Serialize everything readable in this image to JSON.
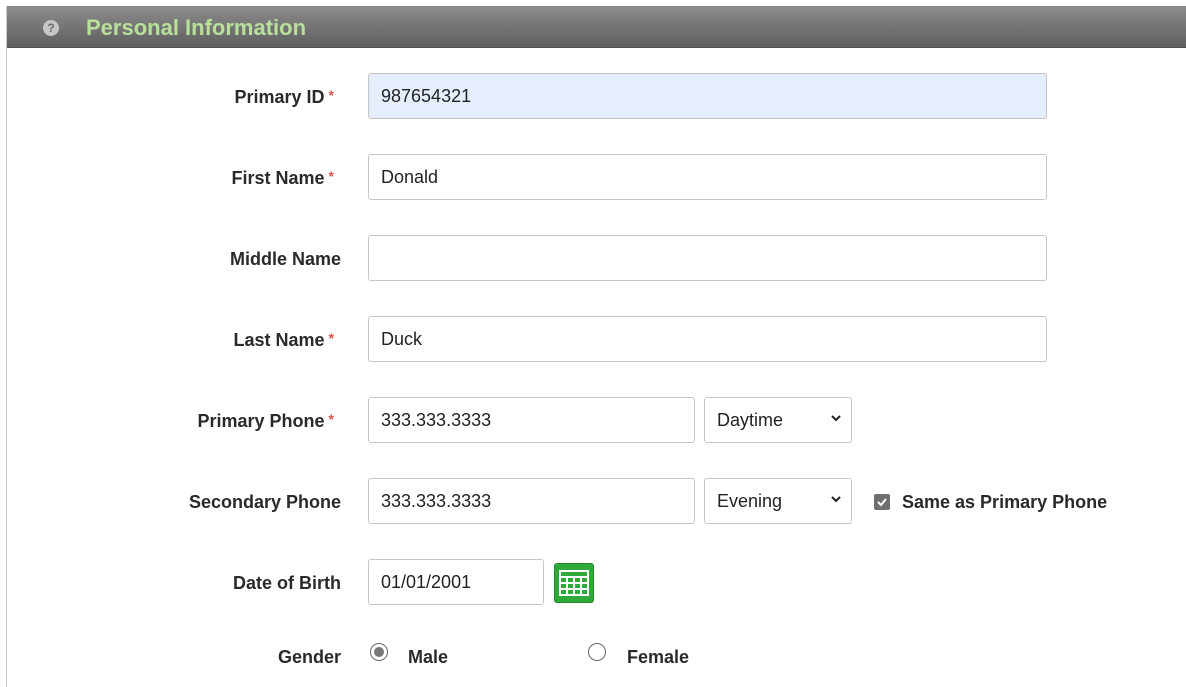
{
  "section": {
    "title": "Personal Information",
    "help_icon": "question-circle-icon"
  },
  "fields": {
    "primary_id": {
      "label": "Primary ID",
      "required": "*",
      "value": "987654321"
    },
    "first_name": {
      "label": "First Name",
      "required": "*",
      "value": "Donald"
    },
    "middle_name": {
      "label": "Middle Name",
      "value": ""
    },
    "last_name": {
      "label": "Last Name",
      "required": "*",
      "value": "Duck"
    },
    "primary_phone": {
      "label": "Primary Phone",
      "required": "*",
      "value": "333.333.3333",
      "type_selected": "Daytime"
    },
    "secondary_phone": {
      "label": "Secondary Phone",
      "value": "333.333.3333",
      "type_selected": "Evening",
      "same_as_label": "Same as Primary Phone",
      "same_as_checked": true
    },
    "date_of_birth": {
      "label": "Date of Birth",
      "value": "01/01/2001",
      "calendar_icon": "calendar-icon"
    },
    "gender": {
      "label": "Gender",
      "options": [
        "Male",
        "Female"
      ],
      "selected": "Male"
    }
  },
  "colors": {
    "header_title": "#b9e09b",
    "required_star": "#d9534f",
    "highlight_input": "#e6eefd",
    "calendar_green": "#2faa3a"
  }
}
